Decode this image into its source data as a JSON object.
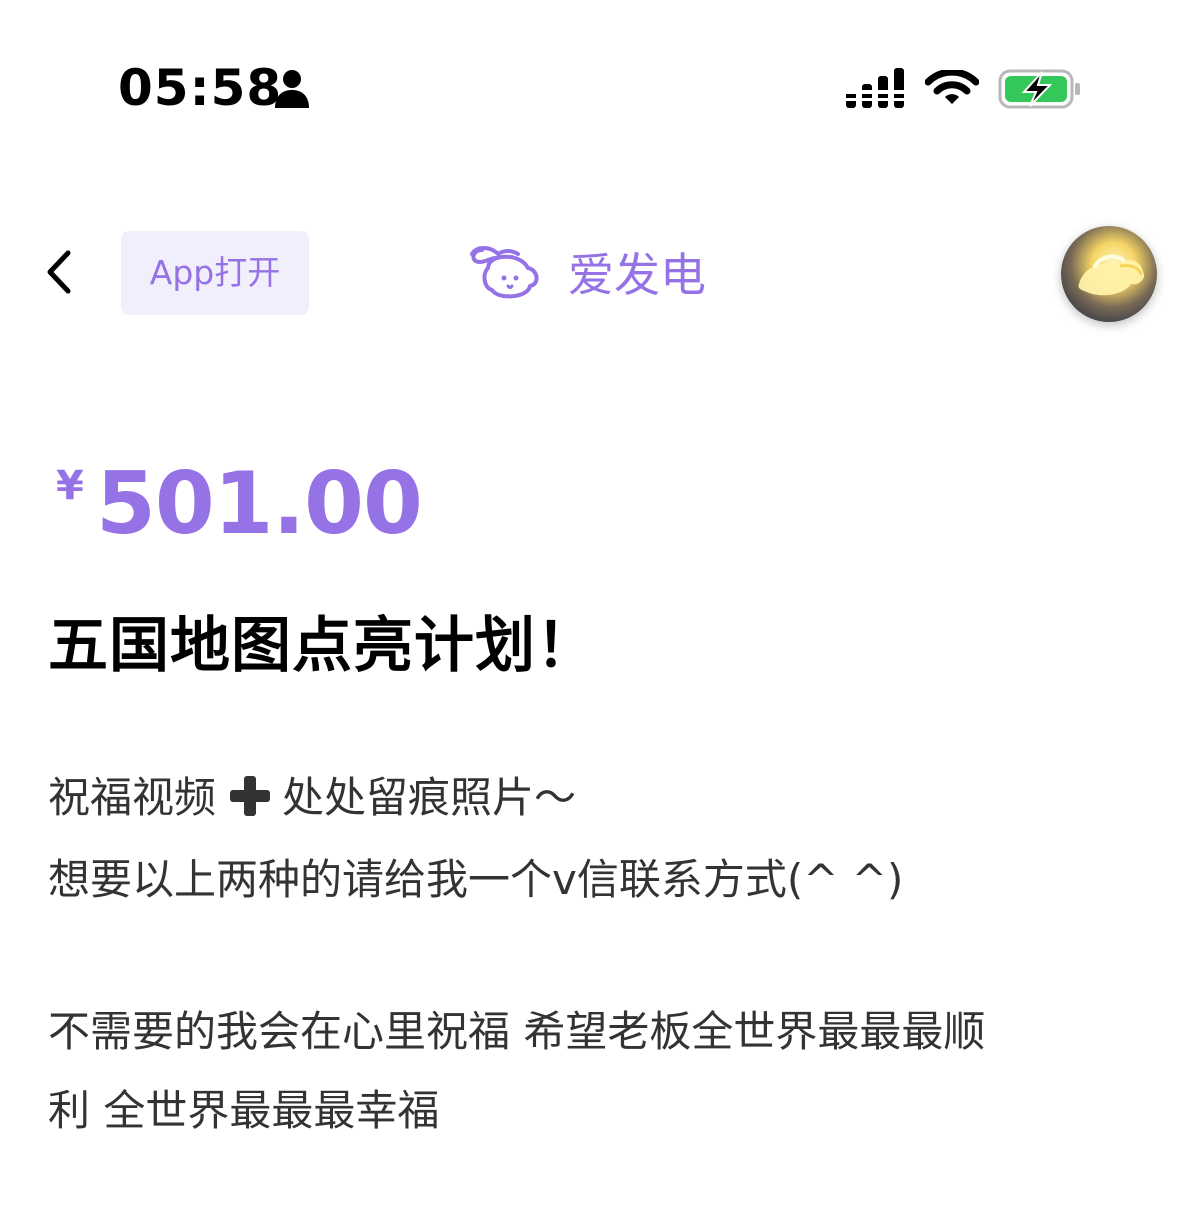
{
  "status_bar": {
    "time": "05:58",
    "icons": [
      "person-icon",
      "cellular-signal-icon",
      "wifi-icon",
      "battery-charging-icon"
    ],
    "battery_color": "#34c759"
  },
  "nav": {
    "back_icon": "chevron-left-icon",
    "app_open_label": "App打开",
    "brand_name": "爱发电",
    "accent_color": "#9572e6"
  },
  "plan": {
    "currency_symbol": "¥",
    "price": "501.00",
    "title": "五国地图点亮计划！",
    "description": {
      "line1_part1": "祝福视频",
      "line1_icon": "plus-icon",
      "line1_part2": "处处留痕照片～",
      "line2": "想要以上两种的请给我一个v信联系方式(^ ^)",
      "line3": "不需要的我会在心里祝福 希望老板全世界最最最顺",
      "line4": "利 全世界最最最幸福"
    }
  }
}
